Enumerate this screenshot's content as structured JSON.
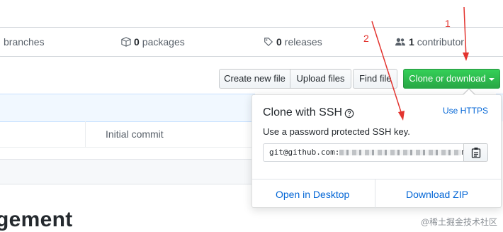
{
  "stats": {
    "branches_label": "branches",
    "packages_count": "0",
    "packages_label": "packages",
    "releases_count": "0",
    "releases_label": "releases",
    "contributors_count": "1",
    "contributors_label": "contributor"
  },
  "actions": {
    "create_new_file": "Create new file",
    "upload_files": "Upload files",
    "find_file": "Find file",
    "clone_or_download": "Clone or download"
  },
  "file_list": {
    "commit_message": "Initial commit"
  },
  "readme": {
    "heading_fragment": "gement"
  },
  "clone_popover": {
    "title": "Clone with SSH",
    "use_https": "Use HTTPS",
    "description": "Use a password protected SSH key.",
    "url_prefix": "git@github.com:",
    "url_suffix": "men",
    "open_in_desktop": "Open in Desktop",
    "download_zip": "Download ZIP"
  },
  "annotations": {
    "step1": "1",
    "step2": "2",
    "color": "#e3342f"
  },
  "watermark": "@稀土掘金技术社区",
  "colors": {
    "accent_green": "#28a745",
    "link_blue": "#0366d6"
  }
}
